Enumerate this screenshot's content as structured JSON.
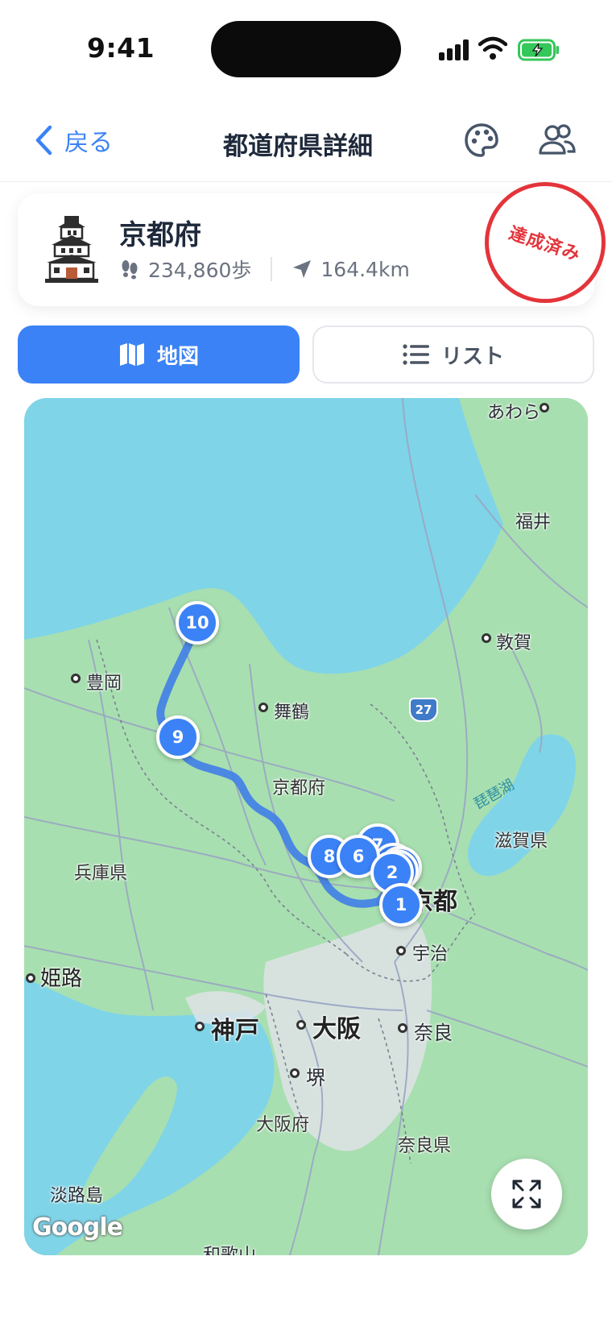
{
  "status_bar": {
    "time": "9:41"
  },
  "nav": {
    "back_label": "戻る",
    "title": "都道府県詳細"
  },
  "prefecture": {
    "name": "京都府",
    "steps": "234,860歩",
    "distance": "164.4km",
    "stamp": "達成済み"
  },
  "tabs": [
    {
      "label": "地図",
      "active": true
    },
    {
      "label": "リスト",
      "active": false
    }
  ],
  "map": {
    "labels": {
      "awara": "あわら",
      "fukui": "福井",
      "tsuruga": "敦賀",
      "toyooka": "豊岡",
      "maizuru": "舞鶴",
      "kyotofu": "京都府",
      "biwako": "琵琶湖",
      "shiga": "滋賀県",
      "hyogo": "兵庫県",
      "kyoto": "京都",
      "uji": "宇治",
      "himeji": "姫路",
      "kobe": "神戸",
      "osaka": "大阪",
      "nara": "奈良",
      "sakai": "堺",
      "osakafu": "大阪府",
      "narakn": "奈良県",
      "awajishima": "淡路島",
      "wakayama": "和歌山"
    },
    "route_badge": "27",
    "pins": [
      "1",
      "2",
      "3",
      "4",
      "5",
      "6",
      "7",
      "8",
      "9",
      "10"
    ],
    "attribution": "Google"
  },
  "colors": {
    "accent": "#3b82f6",
    "stamp": "#e3343a",
    "water": "#7fd4e8",
    "land": "#a8dfb0"
  }
}
